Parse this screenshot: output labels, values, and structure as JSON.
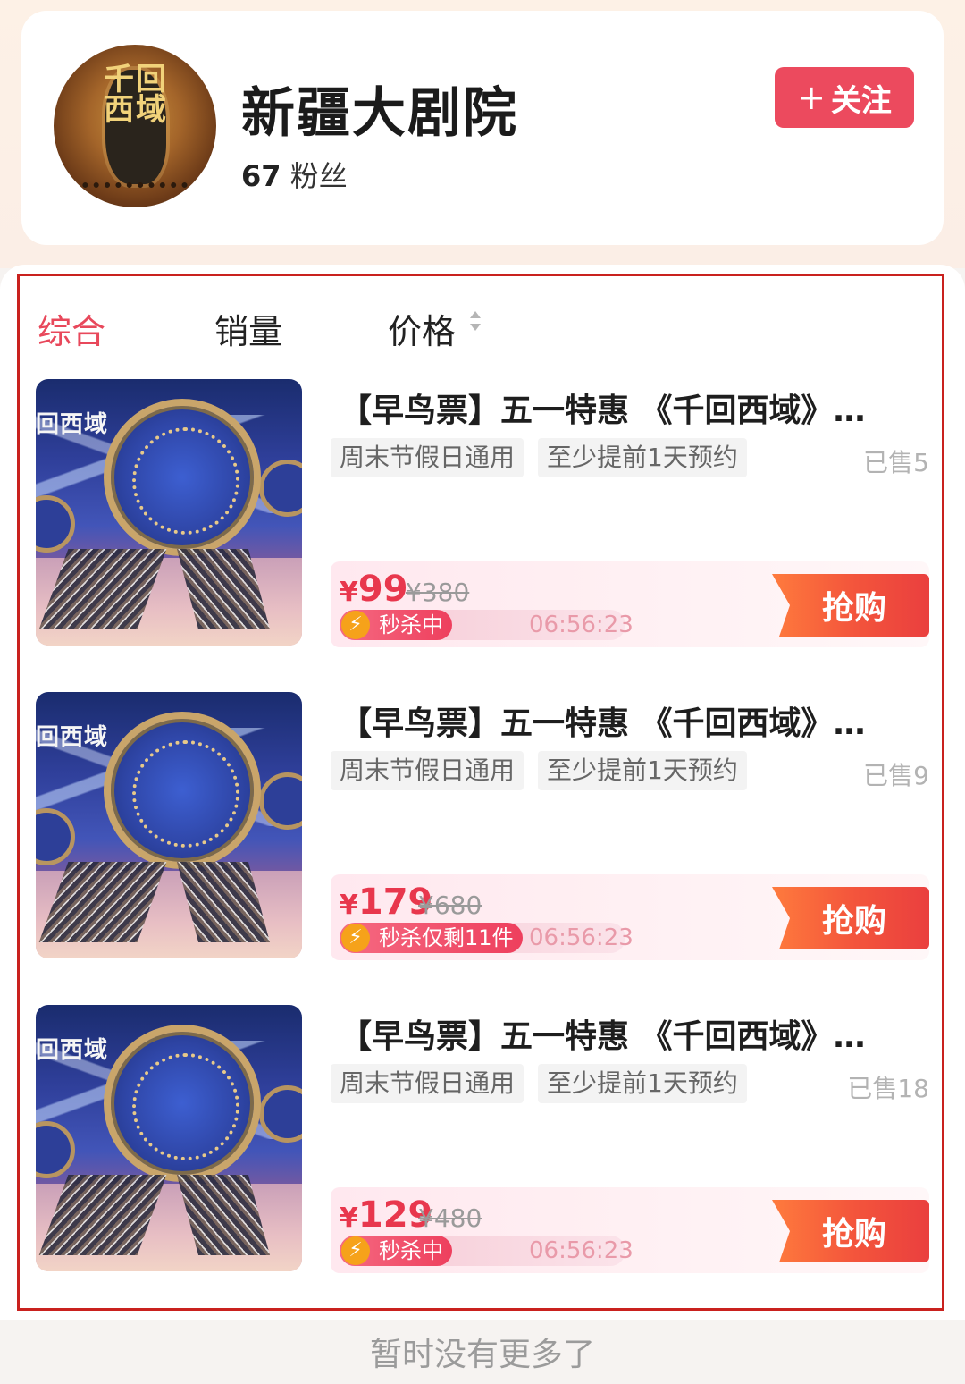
{
  "shop": {
    "name": "新疆大剧院",
    "fans_count": "67",
    "fans_label": "粉丝",
    "follow_label": "关注",
    "avatar_text": "千回西域"
  },
  "sort_tabs": [
    {
      "label": "综合",
      "active": true
    },
    {
      "label": "销量",
      "active": false
    },
    {
      "label": "价格",
      "active": false
    }
  ],
  "products": [
    {
      "title": "【早鸟票】五一特惠 《千回西域》…",
      "tags": [
        "周末节假日通用",
        "至少提前1天预约"
      ],
      "sold": "已售5",
      "price_symbol": "¥",
      "price": "99",
      "original_price": "¥380",
      "flash_label": "秒杀中",
      "countdown": "06:56:23",
      "buy_label": "抢购",
      "thumb_text": "回西域"
    },
    {
      "title": "【早鸟票】五一特惠 《千回西域》…",
      "tags": [
        "周末节假日通用",
        "至少提前1天预约"
      ],
      "sold": "已售9",
      "price_symbol": "¥",
      "price": "179",
      "original_price": "¥680",
      "flash_label": "秒杀仅剩11件",
      "countdown": "06:56:23",
      "buy_label": "抢购",
      "thumb_text": "回西域"
    },
    {
      "title": "【早鸟票】五一特惠 《千回西域》…",
      "tags": [
        "周末节假日通用",
        "至少提前1天预约"
      ],
      "sold": "已售18",
      "price_symbol": "¥",
      "price": "129",
      "original_price": "¥480",
      "flash_label": "秒杀中",
      "countdown": "06:56:23",
      "buy_label": "抢购",
      "thumb_text": "回西域"
    }
  ],
  "footer_text": "暂时没有更多了",
  "colors": {
    "accent": "#e8485b",
    "follow_button": "#ec4a5e",
    "price": "#e8374d",
    "buy_button": "#f3543c",
    "highlight_border": "#c9211e"
  }
}
